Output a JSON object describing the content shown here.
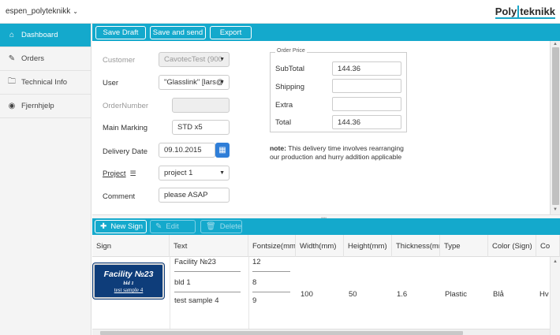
{
  "header": {
    "account": "espen_polyteknikk",
    "logo_part1": "Poly",
    "logo_part2": "teknikk"
  },
  "sidebar": {
    "items": [
      {
        "label": "Dashboard",
        "icon": "home-icon",
        "active": true
      },
      {
        "label": "Orders",
        "icon": "edit-icon",
        "active": false
      },
      {
        "label": "Technical Info",
        "icon": "folder-icon",
        "active": false
      },
      {
        "label": "Fjernhjelp",
        "icon": "lifebuoy-icon",
        "active": false
      }
    ]
  },
  "toolbar": {
    "save_draft": "Save Draft",
    "save_and_send": "Save and send",
    "export": "Export"
  },
  "form": {
    "customer_label": "Customer",
    "customer_value": "CavotecTest (900",
    "user_label": "User",
    "user_value": "\"Glasslink\" [lars@",
    "order_number_label": "OrderNumber",
    "order_number_value": "",
    "main_marking_label": "Main Marking",
    "main_marking_value": "STD x5",
    "delivery_date_label": "Delivery Date",
    "delivery_date_value": "09.10.2015",
    "project_label": "Project",
    "project_value": "project 1",
    "comment_label": "Comment",
    "comment_value": "please ASAP"
  },
  "order_price": {
    "legend": "Order Price",
    "subtotal_label": "SubTotal",
    "subtotal_value": "144.36",
    "shipping_label": "Shipping",
    "shipping_value": "",
    "extra_label": "Extra",
    "extra_value": "",
    "total_label": "Total",
    "total_value": "144.36"
  },
  "note": {
    "bold": "note:",
    "text": " This delivery time involves rearranging our production and hurry addition applicable"
  },
  "grid_toolbar": {
    "new_sign": "New Sign",
    "edit": "Edit",
    "delete": "Delete"
  },
  "grid": {
    "columns": [
      "Sign",
      "Text",
      "Fontsize(mm)",
      "Width(mm)",
      "Height(mm)",
      "Thickness(mm",
      "Type",
      "Color (Sign)",
      "Co"
    ],
    "row": {
      "sign_preview": {
        "line1": "Facility №23",
        "line2": "bld 1",
        "line3": "test sample 4"
      },
      "texts": [
        "Facility №23",
        "bld 1",
        "test sample 4"
      ],
      "fontsizes": [
        "12",
        "8",
        "9"
      ],
      "width": "100",
      "height": "50",
      "thickness": "1.6",
      "type": "Plastic",
      "color": "Blå",
      "color2": "Hv"
    }
  },
  "colors": {
    "accent": "#14a9cc",
    "calendar_button": "#2f7ed8",
    "sign_background": "#0e3d7a"
  }
}
